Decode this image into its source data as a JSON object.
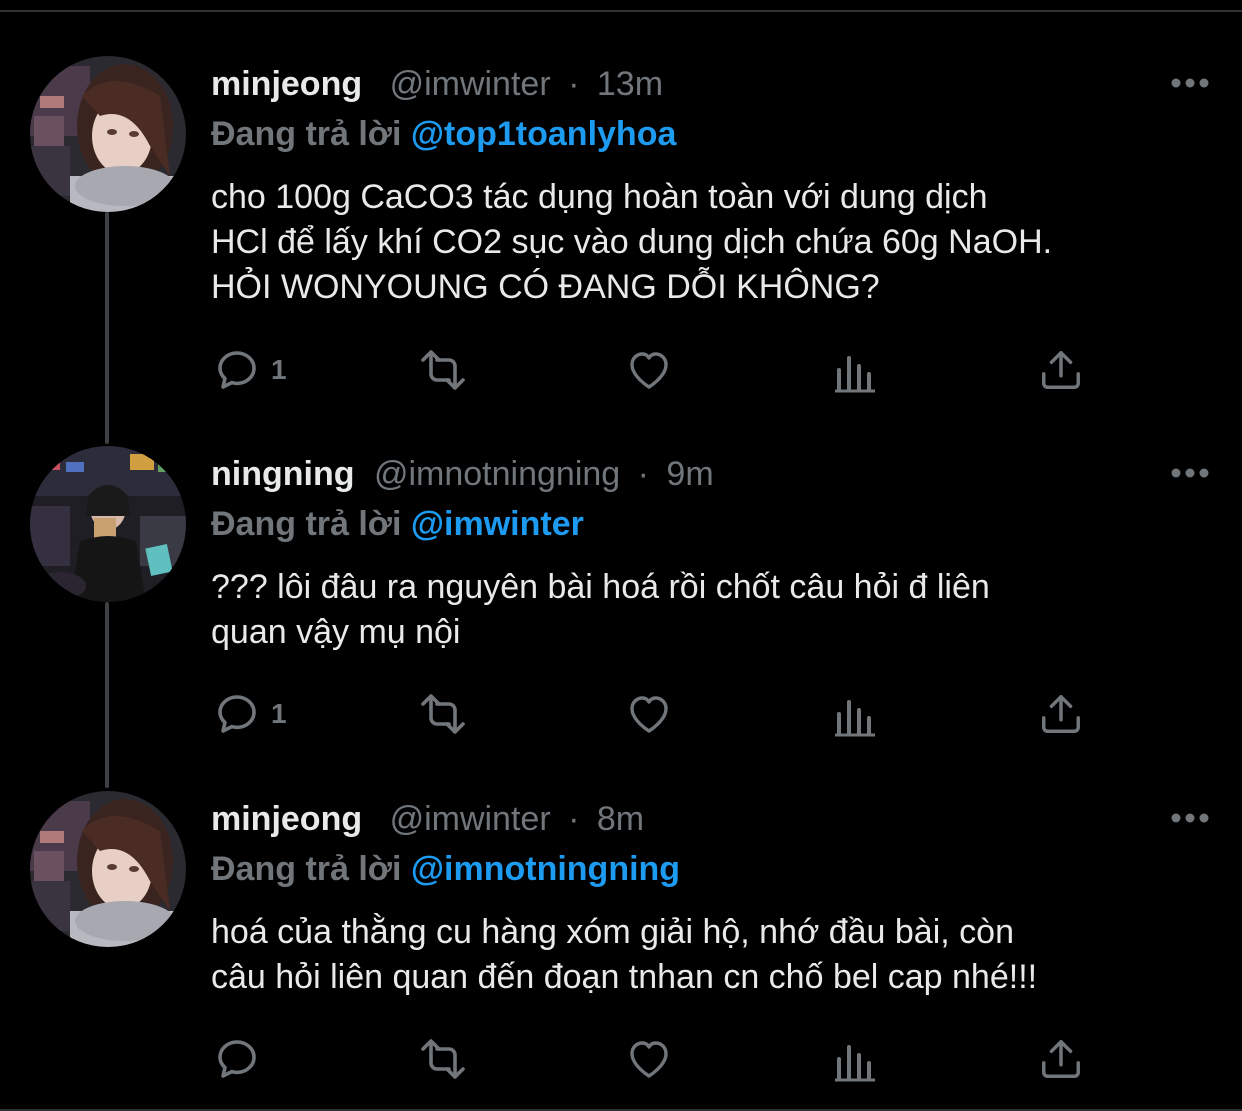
{
  "colors": {
    "background": "#000000",
    "text": "#e7e9ea",
    "muted": "#71767b",
    "link": "#1d9bf0",
    "thread_line": "#3e4144"
  },
  "tweets": [
    {
      "name": "minjeong",
      "handle": "@imwinter",
      "separator": "·",
      "time": "13m",
      "reply_prefix": "Đang trả lời",
      "reply_to": "@top1toanlyhoa",
      "text": "cho 100g CaCO3 tác dụng hoàn toàn với dung dịch\nHCl để lấy khí CO2 sục vào dung dịch chứa 60g NaOH.\nHỎI WONYOUNG CÓ ĐANG DỖI KHÔNG?",
      "reply_count": "1",
      "avatar": "avatar-minjeong",
      "icons": [
        "reply-icon",
        "retweet-icon",
        "like-icon",
        "analytics-icon",
        "share-icon",
        "more-icon"
      ]
    },
    {
      "name": "ningning",
      "handle": "@imnotningning",
      "separator": "·",
      "time": "9m",
      "reply_prefix": "Đang trả lời",
      "reply_to": "@imwinter",
      "text": "??? lôi đâu ra nguyên bài hoá rồi chốt câu hỏi đ liên\nquan vậy mụ nội",
      "reply_count": "1",
      "avatar": "avatar-ningning",
      "icons": [
        "reply-icon",
        "retweet-icon",
        "like-icon",
        "analytics-icon",
        "share-icon",
        "more-icon"
      ]
    },
    {
      "name": "minjeong",
      "handle": "@imwinter",
      "separator": "·",
      "time": "8m",
      "reply_prefix": "Đang trả lời",
      "reply_to": "@imnotningning",
      "text": "hoá của thằng cu hàng xóm giải hộ, nhớ đầu bài, còn\ncâu hỏi liên quan đến đoạn tnhan cn chố bel cap nhé!!!",
      "reply_count": "",
      "avatar": "avatar-minjeong",
      "icons": [
        "reply-icon",
        "retweet-icon",
        "like-icon",
        "analytics-icon",
        "share-icon",
        "more-icon"
      ]
    }
  ]
}
